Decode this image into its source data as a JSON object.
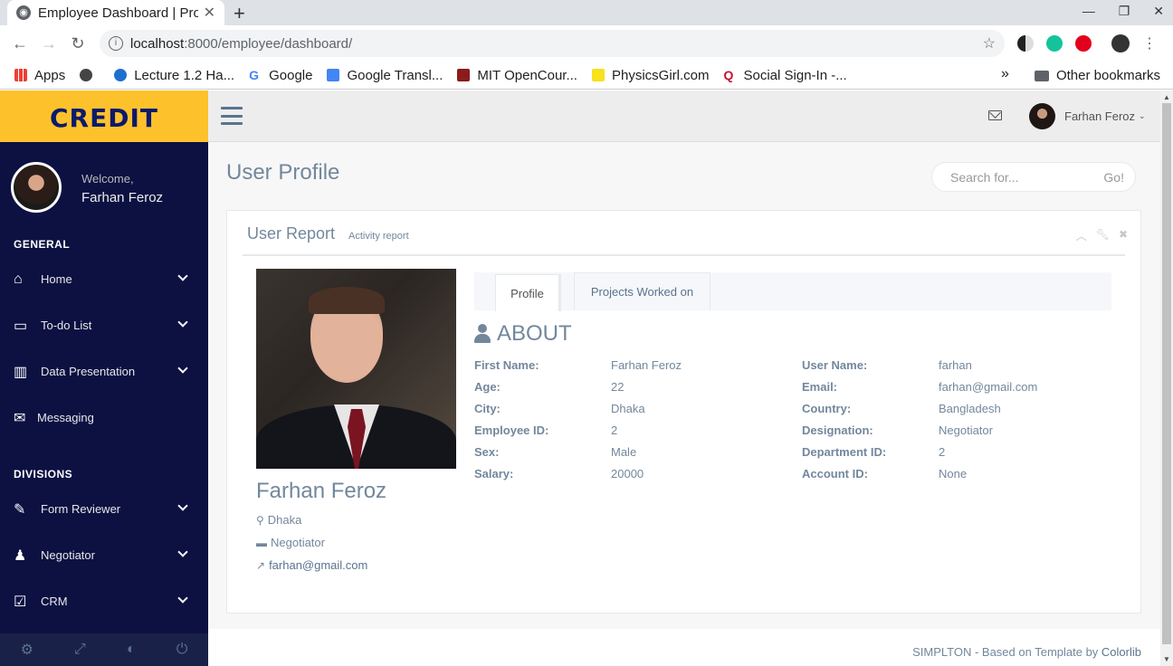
{
  "browser": {
    "tab_title": "Employee Dashboard | Pro",
    "tab_close": "✕",
    "new_tab": "+",
    "url_host": "localhost",
    "url_path": ":8000/employee/dashboard/",
    "window_controls": [
      "—",
      "❐",
      "✕"
    ]
  },
  "bookmarks": {
    "items": [
      "Apps",
      "",
      "Lecture 1.2 Ha...",
      "Google",
      "Google Transl...",
      "MIT OpenCour...",
      "PhysicsGirl.com",
      "Social Sign-In -..."
    ],
    "more": "»",
    "other": "Other bookmarks"
  },
  "sidebar": {
    "brand": "CREDIT",
    "welcome": "Welcome,",
    "user_name": "Farhan Feroz",
    "general_title": "GENERAL",
    "general_items": [
      {
        "label": "Home",
        "icon": "home-icon"
      },
      {
        "label": "To-do List",
        "icon": "desktop-icon"
      },
      {
        "label": "Data Presentation",
        "icon": "bar-chart-icon"
      },
      {
        "label": "Messaging",
        "icon": "envelope-icon"
      }
    ],
    "divisions_title": "DIVISIONS",
    "division_items": [
      {
        "label": "Form Reviewer",
        "icon": "edit-icon"
      },
      {
        "label": "Negotiator",
        "icon": "users-icon"
      },
      {
        "label": "CRM",
        "icon": "check-square-icon"
      }
    ],
    "footer_icons": [
      "gear-icon",
      "fullscreen-icon",
      "eye-slash-icon",
      "power-icon"
    ]
  },
  "topnav": {
    "user_name": "Farhan Feroz"
  },
  "page": {
    "title": "User Profile",
    "search_placeholder": "Search for...",
    "search_go": "Go!"
  },
  "panel": {
    "title": "User Report",
    "subtitle": "Activity report",
    "employee": {
      "name": "Farhan Feroz",
      "city": "Dhaka",
      "designation": "Negotiator",
      "email": "farhan@gmail.com"
    },
    "tabs": [
      "Profile",
      "Projects Worked on"
    ],
    "about_title": "ABOUT",
    "fields_left": [
      {
        "label": "First Name:",
        "value": "Farhan Feroz"
      },
      {
        "label": "Age:",
        "value": "22"
      },
      {
        "label": "City:",
        "value": "Dhaka"
      },
      {
        "label": "Employee ID:",
        "value": "2"
      },
      {
        "label": "Sex:",
        "value": "Male"
      },
      {
        "label": "Salary:",
        "value": "20000"
      }
    ],
    "fields_right": [
      {
        "label": "User Name:",
        "value": "farhan"
      },
      {
        "label": "Email:",
        "value": "farhan@gmail.com"
      },
      {
        "label": "Country:",
        "value": "Bangladesh"
      },
      {
        "label": "Designation:",
        "value": "Negotiator"
      },
      {
        "label": "Department ID:",
        "value": "2"
      },
      {
        "label": "Account ID:",
        "value": "None"
      }
    ]
  },
  "footer": {
    "text": "SIMPLTON - Based on Template by ",
    "link": "Colorlib"
  },
  "colors": {
    "sidebar_bg": "#0c1142",
    "brand_bg": "#fdc22b",
    "brand_text": "#0c1a6b"
  }
}
